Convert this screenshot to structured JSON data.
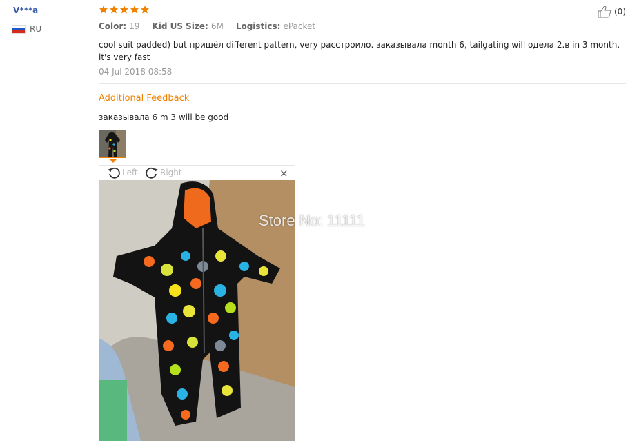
{
  "reviewer": {
    "name": "V***a",
    "country_code": "RU",
    "flag_colors": [
      "#ffffff",
      "#1c57c5",
      "#d52b1e"
    ]
  },
  "rating": {
    "stars": 5,
    "color": "#f08200"
  },
  "helpful": {
    "count": "(0)"
  },
  "attributes": [
    {
      "label": "Color:",
      "value": "19"
    },
    {
      "label": "Kid US Size:",
      "value": "6M"
    },
    {
      "label": "Logistics:",
      "value": "ePacket"
    }
  ],
  "review": {
    "text": "cool suit padded) but пришёл different pattern, very расстроило. заказывала month 6, tailgating will одела 2.в in 3 month. it's very fast",
    "date": "04 Jul 2018 08:58"
  },
  "additional": {
    "title": "Additional Feedback",
    "text": "заказывала 6 m 3 will be good"
  },
  "viewer": {
    "rotate_left": "Left",
    "rotate_right": "Right",
    "close": "×"
  },
  "photo": {
    "watermark": "Store No: 11111"
  }
}
